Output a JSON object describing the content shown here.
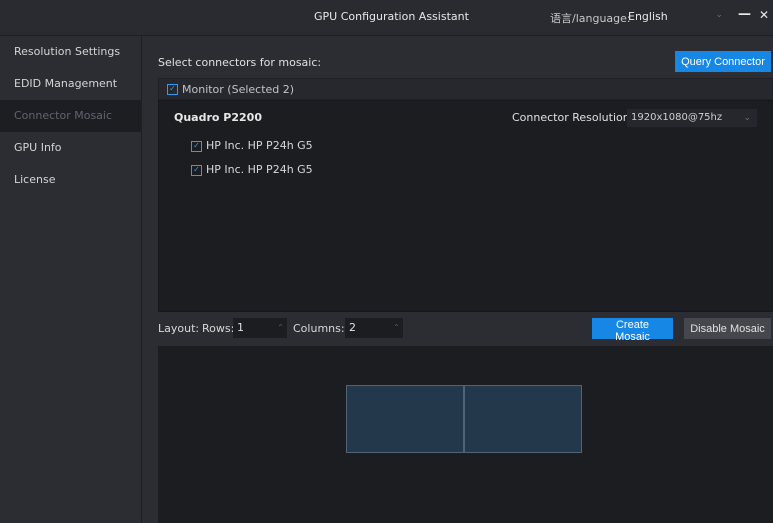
{
  "titlebar": {
    "title": "GPU Configuration Assistant",
    "language_label": "语言/language:",
    "language_value": "English",
    "minimize_icon": "—",
    "close_icon": "✕"
  },
  "sidebar": {
    "items": [
      {
        "label": "Resolution Settings"
      },
      {
        "label": "EDID Management"
      },
      {
        "label": "Connector Mosaic",
        "active": true
      },
      {
        "label": "GPU Info"
      },
      {
        "label": "License"
      }
    ]
  },
  "main": {
    "select_label": "Select connectors for mosaic:",
    "query_button": "Query Connector",
    "monitor_header": "Monitor (Selected 2)",
    "gpu_name": "Quadro P2200",
    "resolution_label": "Connector Resolution:",
    "resolution_value": "1920x1080@75hz",
    "monitors": [
      {
        "label": "HP Inc. HP P24h G5",
        "checked": true
      },
      {
        "label": "HP Inc. HP P24h G5",
        "checked": true
      }
    ]
  },
  "layout": {
    "label": "Layout:",
    "rows_label": "Rows:",
    "rows_value": "1",
    "columns_label": "Columns:",
    "columns_value": "2",
    "create_button": "Create Mosaic",
    "disable_button": "Disable Mosaic"
  },
  "colors": {
    "accent": "#1787e6",
    "tile_fill": "#24384b",
    "tile_border": "#4d6477"
  }
}
